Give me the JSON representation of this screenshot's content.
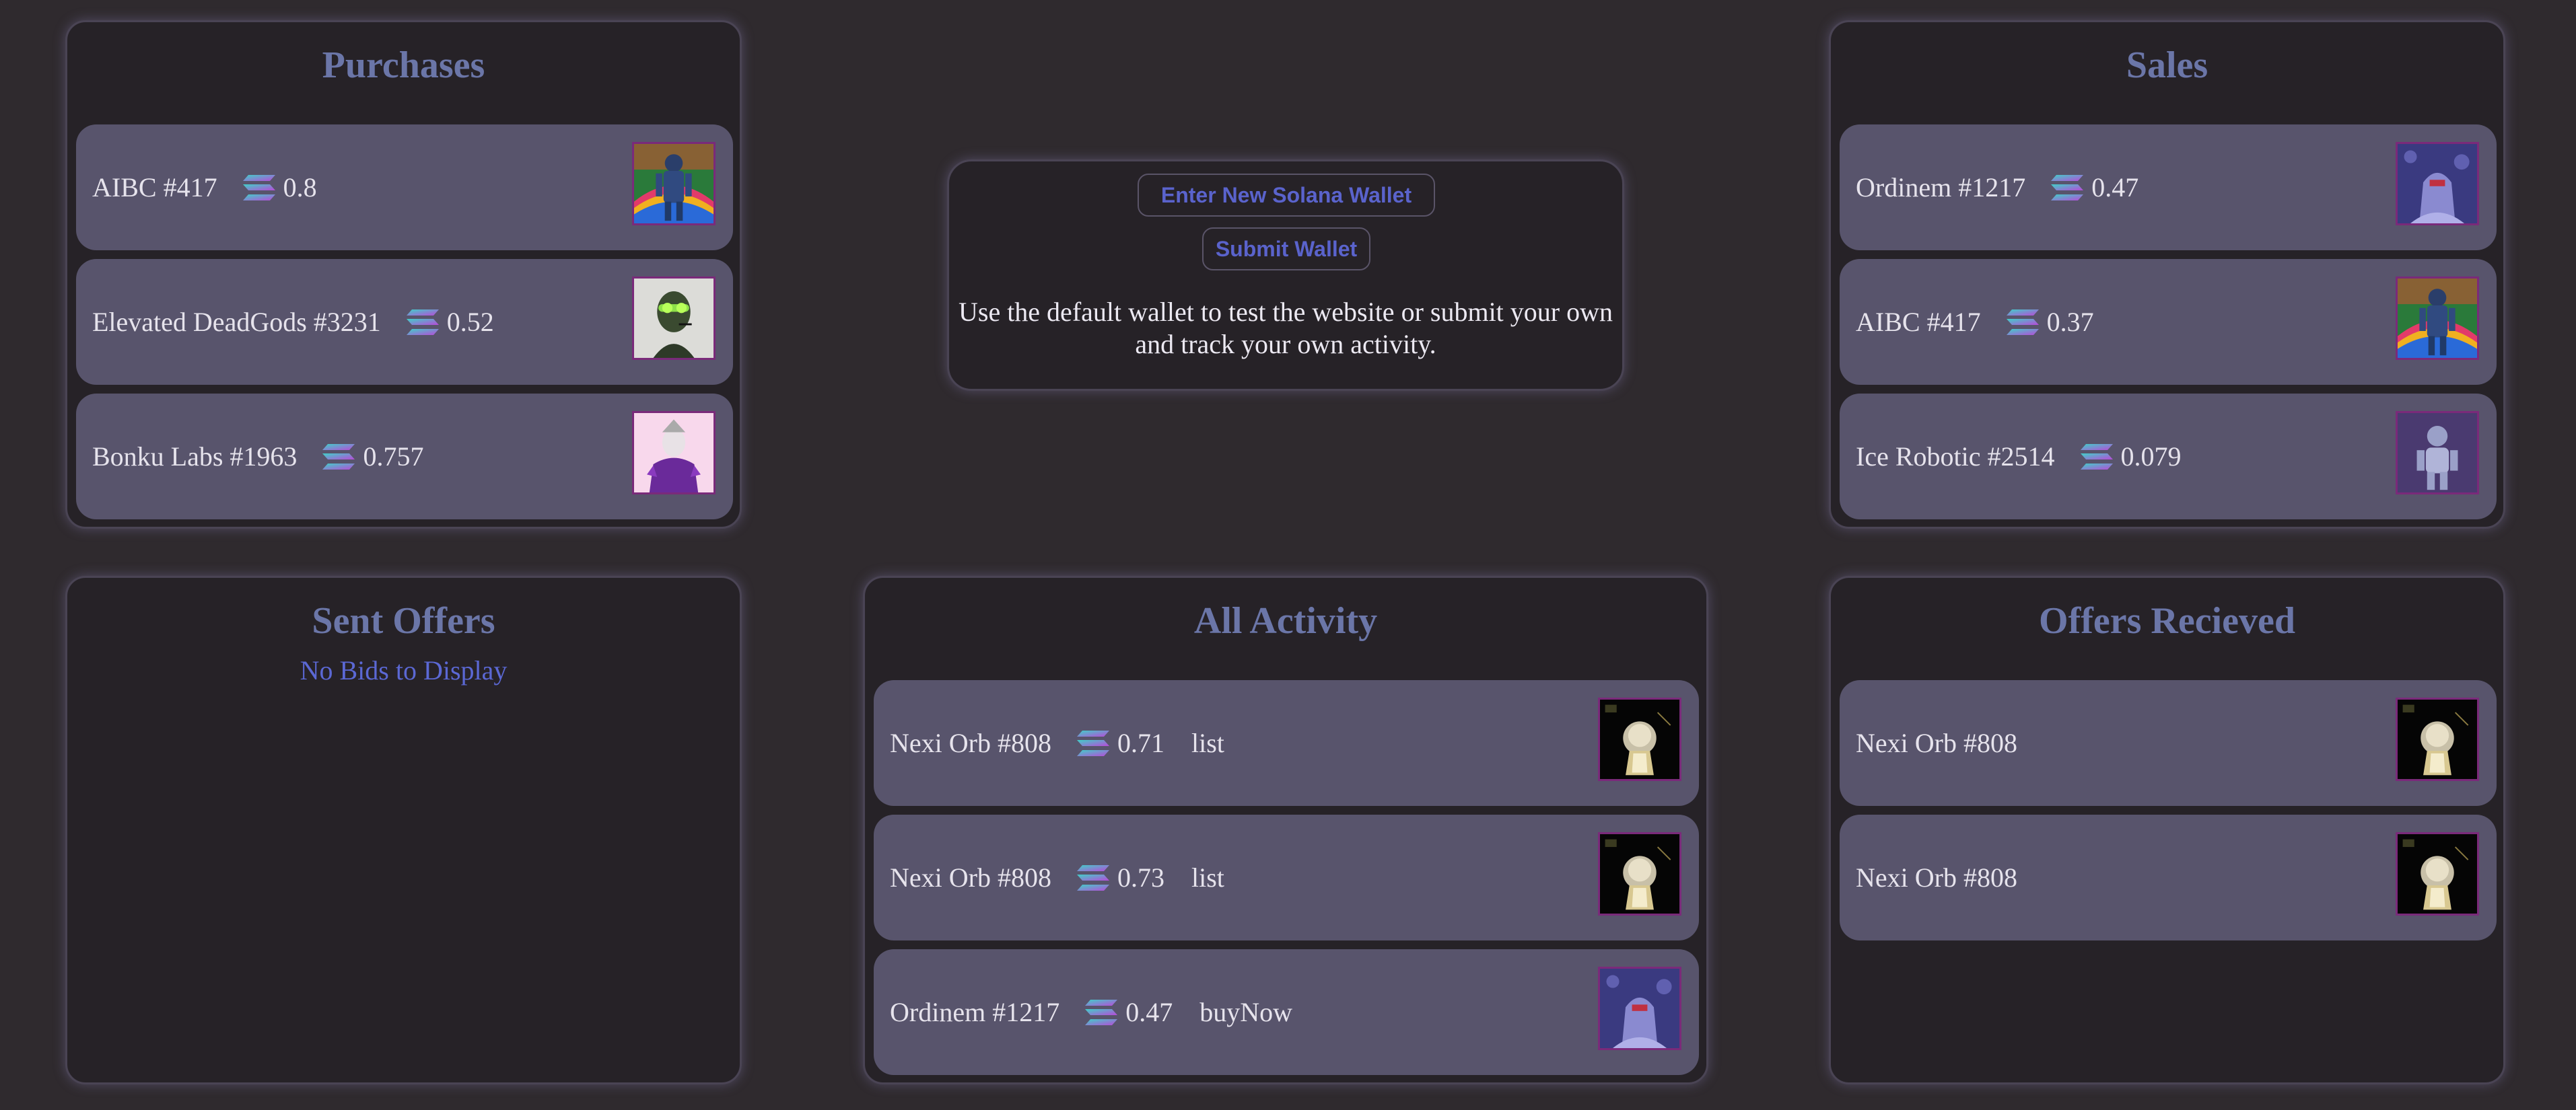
{
  "purchases": {
    "title": "Purchases",
    "items": [
      {
        "name": "AIBC #417",
        "price": "0.8",
        "image": "aibc-nft-thumbnail"
      },
      {
        "name": "Elevated DeadGods #3231",
        "price": "0.52",
        "image": "deadgods-nft-thumbnail"
      },
      {
        "name": "Bonku Labs #1963",
        "price": "0.757",
        "image": "bonku-nft-thumbnail"
      }
    ]
  },
  "wallet": {
    "enter_button": "Enter New Solana Wallet",
    "submit_button": "Submit Wallet",
    "description": "Use the default wallet to test the website or submit your own and track your own activity."
  },
  "sales": {
    "title": "Sales",
    "items": [
      {
        "name": "Ordinem #1217",
        "price": "0.47",
        "image": "ordinem-nft-thumbnail"
      },
      {
        "name": "AIBC #417",
        "price": "0.37",
        "image": "aibc-nft-thumbnail"
      },
      {
        "name": "Ice Robotic #2514",
        "price": "0.079",
        "image": "ice-robotic-nft-thumbnail"
      }
    ]
  },
  "sent_offers": {
    "title": "Sent Offers",
    "empty_text": "No Bids to Display"
  },
  "all_activity": {
    "title": "All Activity",
    "items": [
      {
        "name": "Nexi Orb #808",
        "price": "0.71",
        "type": "list",
        "image": "nexi-orb-nft-thumbnail"
      },
      {
        "name": "Nexi Orb #808",
        "price": "0.73",
        "type": "list",
        "image": "nexi-orb-nft-thumbnail"
      },
      {
        "name": "Ordinem #1217",
        "price": "0.47",
        "type": "buyNow",
        "image": "ordinem-nft-thumbnail"
      }
    ]
  },
  "offers_received": {
    "title": "Offers Recieved",
    "items": [
      {
        "name": "Nexi Orb #808",
        "image": "nexi-orb-nft-thumbnail"
      },
      {
        "name": "Nexi Orb #808",
        "image": "nexi-orb-nft-thumbnail"
      }
    ]
  },
  "colors": {
    "page_bg": "#2f2a2e",
    "panel_bg": "#262227",
    "card_bg": "#58546c",
    "title": "#6b76a8",
    "link_blue": "#5a63cc"
  },
  "icons": {
    "currency": "solana-icon"
  }
}
